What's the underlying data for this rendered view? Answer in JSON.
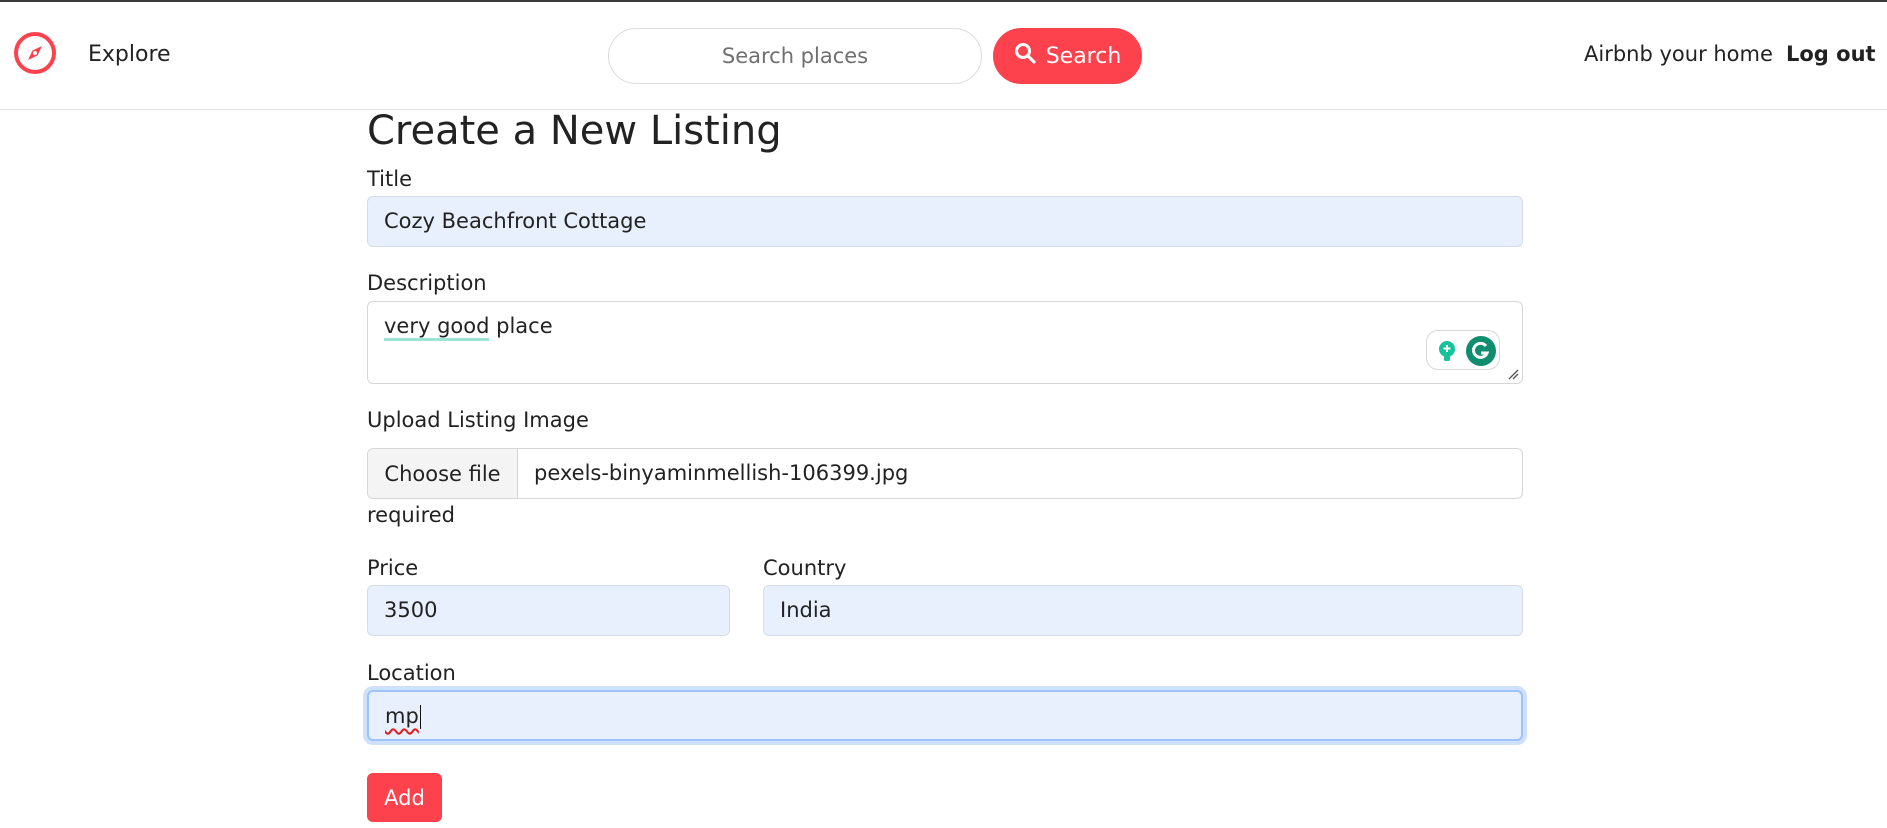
{
  "nav": {
    "logo_icon": "compass-icon",
    "explore_label": "Explore",
    "search_placeholder": "Search places",
    "search_button_label": "Search",
    "search_icon": "search-icon",
    "host_link": "Airbnb your home",
    "logout_label": "Log out",
    "brand_color": "#fe424d"
  },
  "form": {
    "heading": "Create a New Listing",
    "title_label": "Title",
    "title_value": "Cozy Beachfront Cottage",
    "description_label": "Description",
    "description_underlined": "very good",
    "description_rest": " place",
    "image_label": "Upload Listing Image",
    "choose_file_label": "Choose file",
    "file_name": "pexels-binyaminmellish-106399.jpg",
    "required_text": "required",
    "price_label": "Price",
    "price_value": "3500",
    "country_label": "Country",
    "country_value": "India",
    "location_label": "Location",
    "location_value": "mp",
    "add_button_label": "Add",
    "grammarly_icons": [
      "lightbulb-icon",
      "grammarly-icon"
    ]
  }
}
